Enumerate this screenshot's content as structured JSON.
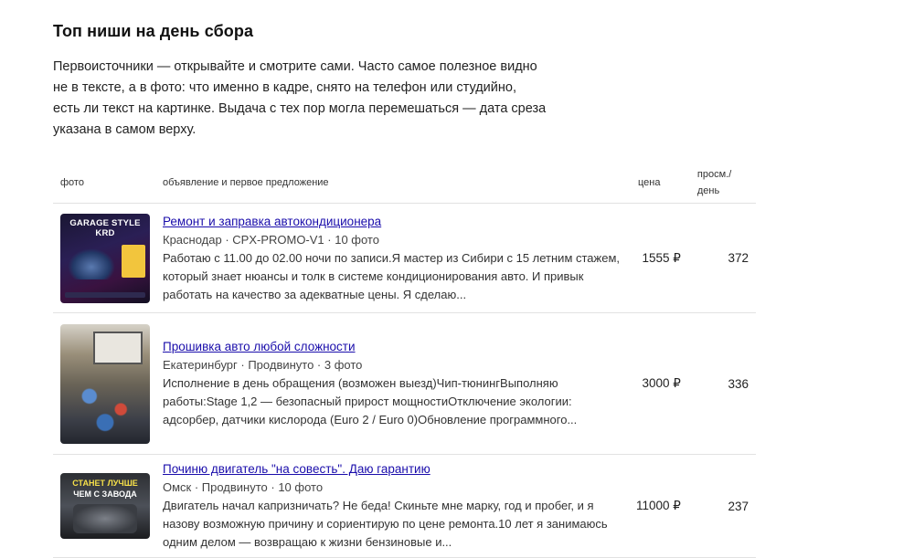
{
  "section": {
    "title": "Топ ниши на день сбора",
    "lead": "Первоисточники — открывайте и смотрите сами. Часто самое полезное видно не в тексте, а в фото: что именно в кадре, снято на телефон или студийно, есть ли текст на картинке. Выдача с тех пор могла перемешаться — дата среза указана в самом верху."
  },
  "table": {
    "headers": {
      "photo": "фото",
      "ad": "объявление и первое предложение",
      "price": "цена",
      "views": "просм./ день"
    },
    "rows": [
      {
        "photo_caption": "GARAGE STYLE KRD",
        "title": "Ремонт и заправка автокондиционера",
        "meta": "Краснодар · CPX-PROMO-V1 · 10 фото",
        "description": "Работаю с 11.00 до 02.00 ночи по записи.Я мастер из Сибири с 15 летним стажем, который знает нюансы и толк в системе кондиционирования авто. И привык работать на качество за адекватные цены. Я сделаю...",
        "price": "1555 ₽",
        "views": "372"
      },
      {
        "photo_caption": "",
        "title": "Прошивка авто любой сложности",
        "meta": "Екатеринбург · Продвинуто · 3 фото",
        "description": "Исполнение в день обращения (возможен выезд)Чип-тюнингВыполняю работы:Stage 1,2 — безопасный прирост мощностиОтключение экологии: адсорбер, датчики кислорода (Euro 2 / Euro 0)Обновление программного...",
        "price": "3000 ₽",
        "views": "336"
      },
      {
        "photo_caption": "СТАНЕТ ЛУЧШЕ ЧЕМ С ЗАВОДА",
        "title": "Починю двигатель \"на совесть\". Даю гарантию",
        "meta": "Омск · Продвинуто · 10 фото",
        "description": "Двигатель начал капризничать? Не беда! Скиньте мне марку, год и пробег, и я назову возможную причину и сориентирую по цене ремонта.10 лет я занимаюсь одним делом — возвращаю к жизни бензиновые и...",
        "price": "11000 ₽",
        "views": "237"
      }
    ]
  }
}
